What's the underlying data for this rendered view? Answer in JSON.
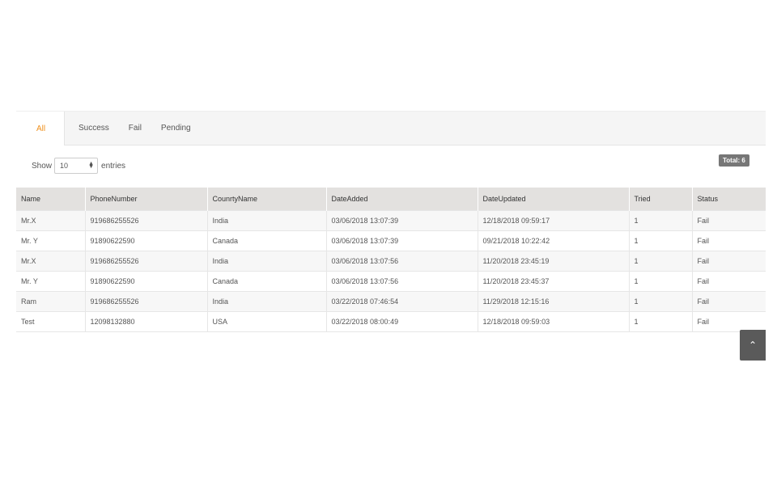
{
  "tabs": [
    {
      "label": "All",
      "active": true
    },
    {
      "label": "Success",
      "active": false
    },
    {
      "label": "Fail",
      "active": false
    },
    {
      "label": "Pending",
      "active": false
    }
  ],
  "length_control": {
    "prefix": "Show",
    "value": "10",
    "suffix": "entries"
  },
  "total_badge": "Total: 6",
  "table": {
    "headers": [
      "Name",
      "PhoneNumber",
      "CounrtyName",
      "DateAdded",
      "DateUpdated",
      "Tried",
      "Status"
    ],
    "rows": [
      [
        "Mr.X",
        "919686255526",
        "India",
        "03/06/2018 13:07:39",
        "12/18/2018 09:59:17",
        "1",
        "Fail"
      ],
      [
        "Mr. Y",
        "91890622590",
        "Canada",
        "03/06/2018 13:07:39",
        "09/21/2018 10:22:42",
        "1",
        "Fail"
      ],
      [
        "Mr.X",
        "919686255526",
        "India",
        "03/06/2018 13:07:56",
        "11/20/2018 23:45:19",
        "1",
        "Fail"
      ],
      [
        "Mr. Y",
        "91890622590",
        "Canada",
        "03/06/2018 13:07:56",
        "11/20/2018 23:45:37",
        "1",
        "Fail"
      ],
      [
        "Ram",
        "919686255526",
        "India",
        "03/22/2018 07:46:54",
        "11/29/2018 12:15:16",
        "1",
        "Fail"
      ],
      [
        "Test",
        "12098132880",
        "USA",
        "03/22/2018 08:00:49",
        "12/18/2018 09:59:03",
        "1",
        "Fail"
      ]
    ]
  },
  "scroll_top": {
    "icon": "chevron-up-icon",
    "glyph": "⌃"
  },
  "colors": {
    "active_tab": "#f0901c",
    "header_bg": "#e3e1df",
    "badge_bg": "#777777",
    "scroll_button_bg": "#5a5a5a"
  }
}
